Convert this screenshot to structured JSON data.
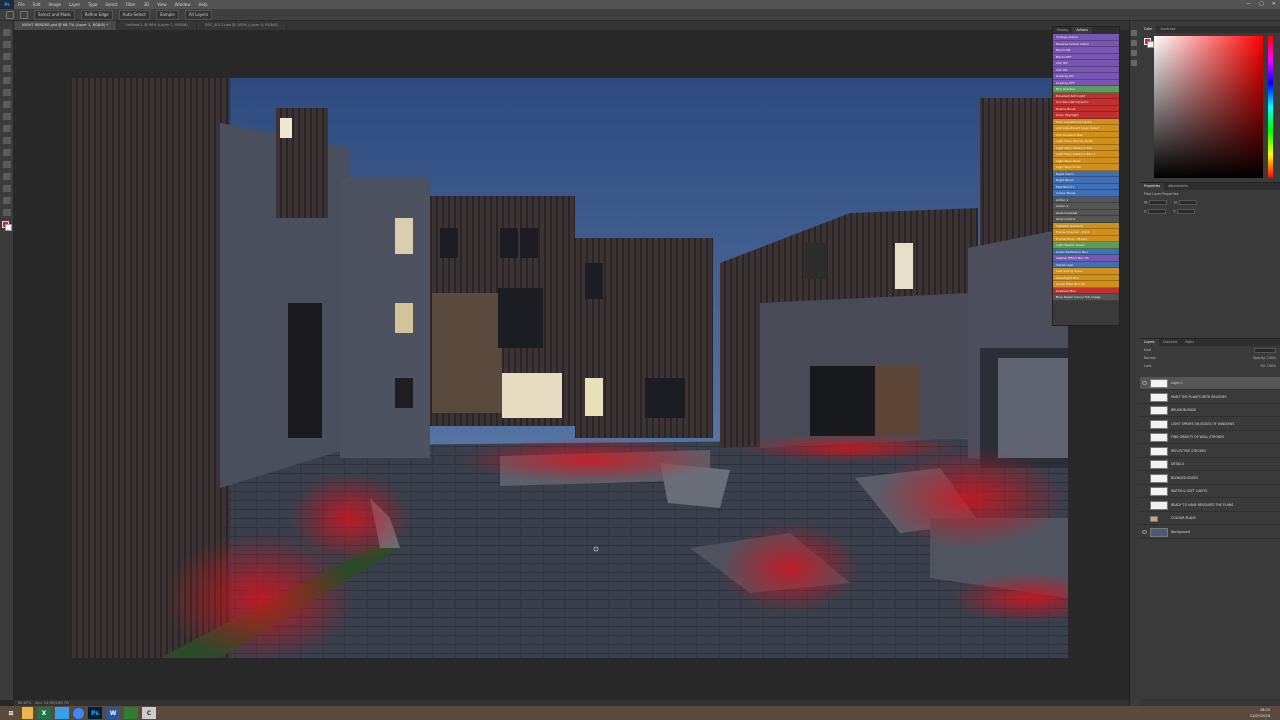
{
  "app": {
    "title": "Adobe Photoshop",
    "logo": "Ps"
  },
  "menubar": {
    "items": [
      "File",
      "Edit",
      "Image",
      "Layer",
      "Type",
      "Select",
      "Filter",
      "3D",
      "View",
      "Window",
      "Help"
    ],
    "window_controls": [
      "—",
      "▢",
      "✕"
    ]
  },
  "options_bar": {
    "buttons": [
      "Select and Mask",
      "Refine Edge",
      "Auto-Select",
      "Sample",
      "All Layers"
    ]
  },
  "document_tabs": [
    {
      "label": "NIGHT RENDER.psd @ 66.7% (Layer 1, RGB/8) *",
      "active": true
    },
    {
      "label": "Untitled-1 @ 66% (Layer 1, RGB/8)",
      "active": false
    },
    {
      "label": "DSC_4017.psd @ 100% (Layer 0, RGB/8)",
      "active": false
    }
  ],
  "status_bar": {
    "zoom": "66.67%",
    "doc": "Doc: 24.9M/186.7M"
  },
  "actions_panel": {
    "tabs": [
      "History",
      "Actions"
    ],
    "actions": [
      {
        "label": "Vintage Action",
        "color": "#7a56b4"
      },
      {
        "label": "Reverse Colour Action",
        "color": "#7a56b4"
      },
      {
        "label": "Blend ON",
        "color": "#7a56b4"
      },
      {
        "label": "Blend OFF",
        "color": "#7a56b4"
      },
      {
        "label": "CS1 ON",
        "color": "#7a56b4"
      },
      {
        "label": "CS1 Off",
        "color": "#7a56b4"
      },
      {
        "label": "Grading ON",
        "color": "#7a56b4"
      },
      {
        "label": "Grading OFF",
        "color": "#7a56b4"
      },
      {
        "label": "Blur Shadow",
        "color": "#5e9a5a"
      },
      {
        "label": "Excellent Soft Light",
        "color": "#c1302e"
      },
      {
        "label": "Sun Blur Ref Dynamic",
        "color": "#c1302e"
      },
      {
        "label": "Drama Boost",
        "color": "#c1302e"
      },
      {
        "label": "Grain Highlight",
        "color": "#c1302e"
      },
      {
        "label": "Tone Adjustment Layers",
        "color": "#d0901c"
      },
      {
        "label": "Add Adjustment Layer Select",
        "color": "#d0901c"
      },
      {
        "label": "Add Gradient Map",
        "color": "#d0901c"
      },
      {
        "label": "Light Rays Volume Burst",
        "color": "#d0901c"
      },
      {
        "label": "Light Rays Distance Blur",
        "color": "#d0901c"
      },
      {
        "label": "Light Rays Distance Blur 2",
        "color": "#d0901c"
      },
      {
        "label": "Light Rays Glow",
        "color": "#d0901c"
      },
      {
        "label": "Light Rays Finish",
        "color": "#d0901c"
      },
      {
        "label": "Night Vision",
        "color": "#3f6fb4"
      },
      {
        "label": "Night Blend",
        "color": "#3f6fb4"
      },
      {
        "label": "Mist Blend 1",
        "color": "#3f6fb4"
      },
      {
        "label": "Colour Boost",
        "color": "#3f6fb4"
      },
      {
        "label": "Action 1",
        "color": "#555555"
      },
      {
        "label": "Action 2",
        "color": "#555555"
      },
      {
        "label": "Glow Contrast",
        "color": "#555555"
      },
      {
        "label": "Glow Control",
        "color": "#555555"
      },
      {
        "label": "Vignette Gradient",
        "color": "#d0901c"
      },
      {
        "label": "Frame Channel - Vivid",
        "color": "#d0901c"
      },
      {
        "label": "Frame Mono - Muted",
        "color": "#d0901c"
      },
      {
        "label": "Light Beams Green",
        "color": "#5e9a5a"
      },
      {
        "label": "Green Reflection Blur",
        "color": "#3f6fb4"
      },
      {
        "label": "Leather Effect Blur PS",
        "color": "#7a56b4"
      },
      {
        "label": "Yellow Leak",
        "color": "#3f6fb4"
      },
      {
        "label": "Leaf Spring Green",
        "color": "#d0901c"
      },
      {
        "label": "Streetlight Blur",
        "color": "#d0901c"
      },
      {
        "label": "Ghost Filter Blur PS",
        "color": "#d0901c"
      },
      {
        "label": "Gradient Blur",
        "color": "#c1302e"
      },
      {
        "label": "Blue Steam Colour Full Image",
        "color": "#555555"
      }
    ]
  },
  "color_panel": {
    "tabs": [
      "Color",
      "Swatches"
    ],
    "foreground": "#e11c23",
    "background": "#ffffff"
  },
  "properties_panel": {
    "tabs": [
      "Properties",
      "Adjustments"
    ],
    "title": "Pixel Layer Properties",
    "w_label": "W:",
    "h_label": "H:",
    "x_label": "X:",
    "y_label": "Y:"
  },
  "layers_panel": {
    "tabs": [
      "Layers",
      "Channels",
      "Paths"
    ],
    "kind": "Kind",
    "blend_mode": "Normal",
    "opacity_label": "Opacity:",
    "opacity": "100%",
    "lock_label": "Lock:",
    "fill_label": "Fill:",
    "fill": "100%",
    "layers": [
      {
        "name": "Layer 1",
        "selected": true,
        "visible": true,
        "group": false
      },
      {
        "name": "PAINT THE PLANTS WITH BRUSHES",
        "selected": false,
        "visible": false,
        "group": false
      },
      {
        "name": "BRUSH BLENDS",
        "selected": false,
        "visible": false,
        "group": false
      },
      {
        "name": "LIGHT SPRAYS ON EDGES OF WINDOWS",
        "selected": false,
        "visible": false,
        "group": false
      },
      {
        "name": "FIND GRAVITY OF WALL STROKES",
        "selected": false,
        "visible": false,
        "group": false
      },
      {
        "name": "REFLECTIVE STROKES",
        "selected": false,
        "visible": false,
        "group": false
      },
      {
        "name": "DETAILS",
        "selected": false,
        "visible": false,
        "group": false
      },
      {
        "name": "BLENDED EDGES",
        "selected": false,
        "visible": false,
        "group": false
      },
      {
        "name": "WATER & SOFT LIGHTS",
        "selected": false,
        "visible": false,
        "group": false
      },
      {
        "name": "READY TO HAVE RESOLVED THE PLANS",
        "selected": false,
        "visible": false,
        "group": false
      },
      {
        "name": "COLOUR PLANS",
        "selected": false,
        "visible": false,
        "group": true
      },
      {
        "name": "Background",
        "selected": false,
        "visible": true,
        "group": false
      }
    ]
  },
  "taskbar": {
    "time": "18:20",
    "date": "11/07/2018"
  }
}
